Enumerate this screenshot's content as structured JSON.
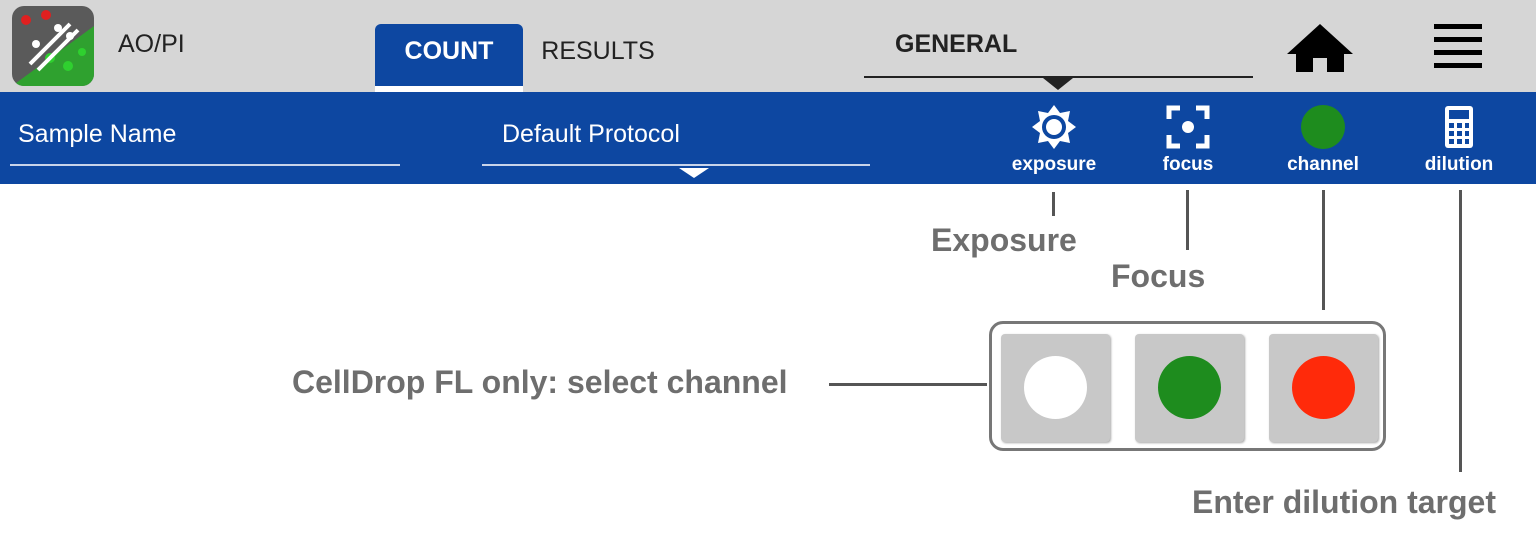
{
  "header": {
    "app_icon": "cell-count-app-icon",
    "protocol_label": "AO/PI",
    "tabs": [
      {
        "label": "COUNT",
        "active": true
      },
      {
        "label": "RESULTS",
        "active": false
      }
    ],
    "section_dropdown": "GENERAL",
    "home_icon": "home-icon",
    "menu_icon": "hamburger-menu-icon"
  },
  "toolbar": {
    "sample_name_placeholder": "Sample Name",
    "protocol_value": "Default Protocol",
    "tools": [
      {
        "label": "exposure",
        "icon": "brightness-icon"
      },
      {
        "label": "focus",
        "icon": "focus-icon"
      },
      {
        "label": "channel",
        "icon": "channel-dot-icon",
        "color": "#1e8c1e"
      },
      {
        "label": "dilution",
        "icon": "calculator-icon"
      }
    ]
  },
  "annotations": {
    "exposure": "Exposure",
    "focus": "Focus",
    "channel": "CellDrop FL only: select channel",
    "dilution": "Enter dilution target"
  },
  "channels": [
    {
      "name": "white",
      "color": "#ffffff"
    },
    {
      "name": "green",
      "color": "#1e8c1e"
    },
    {
      "name": "red",
      "color": "#ff2a0a"
    }
  ],
  "colors": {
    "accent": "#0d47a1",
    "topbar": "#d6d6d6",
    "annotation_text": "#6e6e6e"
  }
}
